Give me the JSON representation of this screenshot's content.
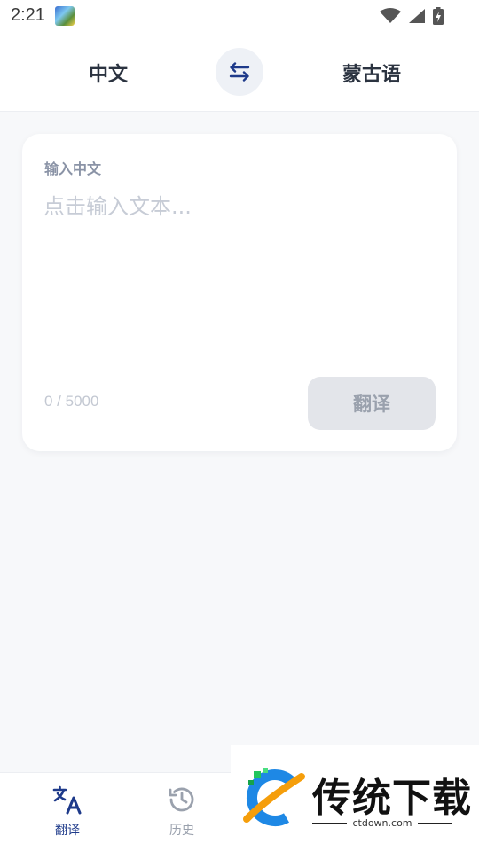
{
  "status_bar": {
    "time": "2:21",
    "icons": [
      "app-thumbnail-icon",
      "wifi-icon",
      "signal-icon",
      "battery-charging-icon"
    ]
  },
  "header": {
    "source_language": "中文",
    "target_language": "蒙古语",
    "swap_icon": "swap-arrows-icon"
  },
  "input_card": {
    "label": "输入中文",
    "placeholder": "点击输入文本...",
    "value": "",
    "char_count": "0 / 5000",
    "translate_button": "翻译"
  },
  "bottom_nav": {
    "items": [
      {
        "label": "翻译",
        "icon": "translate-icon",
        "active": true
      },
      {
        "label": "历史",
        "icon": "history-icon",
        "active": false
      }
    ]
  },
  "watermark": {
    "title": "传统下载",
    "url": "ctdown.com"
  },
  "colors": {
    "accent": "#1e3a8a",
    "background": "#f7f8fa",
    "card": "#ffffff",
    "disabled_button": "#e3e5ea"
  }
}
